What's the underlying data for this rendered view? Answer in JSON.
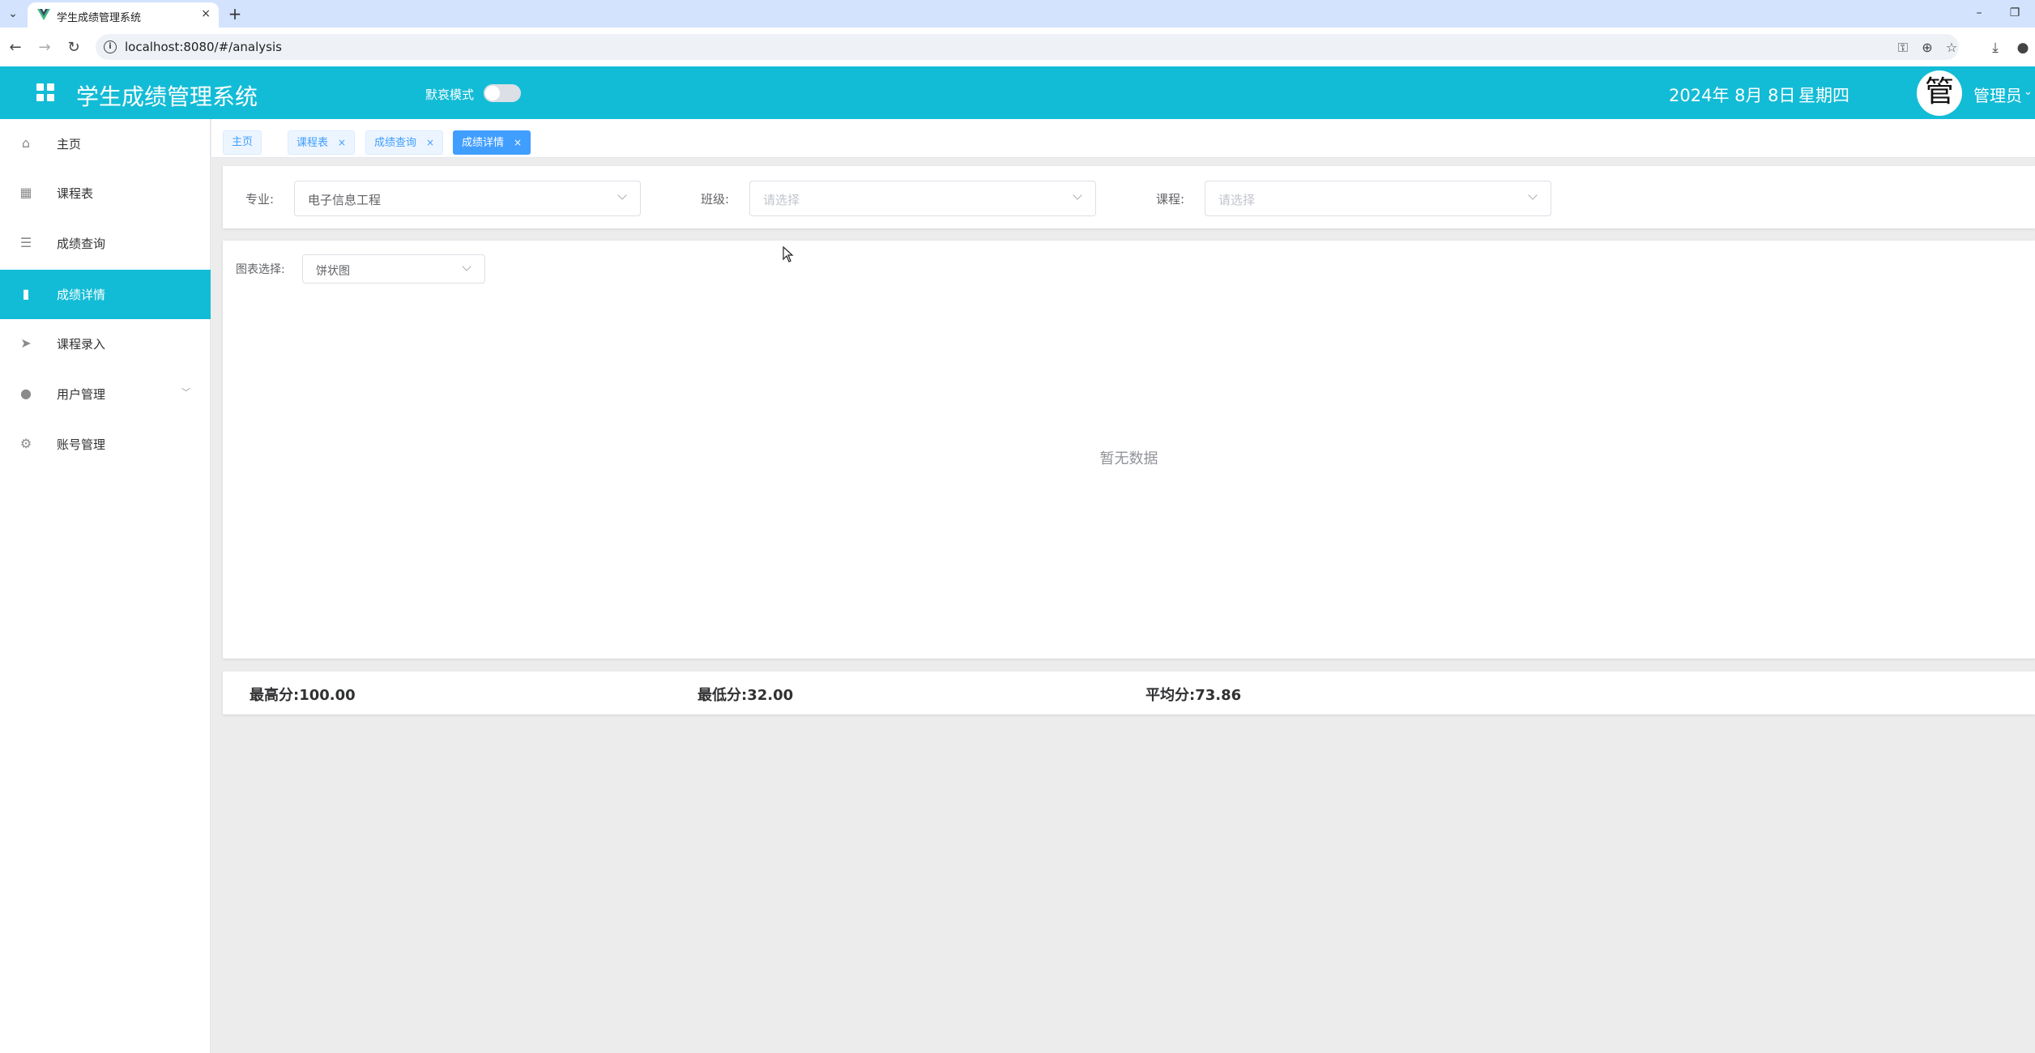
{
  "browser": {
    "tab_title": "学生成绩管理系统",
    "tab_close": "×",
    "new_tab": "+",
    "url": "localhost:8080/#/analysis",
    "icons": [
      "tab-search-icon",
      "back-icon",
      "forward-icon",
      "reload-icon",
      "site-info-icon",
      "password-key-icon",
      "zoom-icon",
      "bookmark-star-icon",
      "download-icon",
      "profile-icon",
      "minimize-icon",
      "restore-icon"
    ]
  },
  "header": {
    "title": "学生成绩管理系统",
    "mode_label": "默哀模式",
    "date": "2024年 8月 8日",
    "weekday": "星期四",
    "avatar_char": "管",
    "user_name": "管理员",
    "accent_color": "#13bcd6"
  },
  "sidebar": {
    "items": [
      {
        "label": "主页",
        "icon": "home-icon",
        "active": false
      },
      {
        "label": "课程表",
        "icon": "grid-icon",
        "active": false
      },
      {
        "label": "成绩查询",
        "icon": "list-icon",
        "active": false
      },
      {
        "label": "成绩详情",
        "icon": "bar-chart-icon",
        "active": true
      },
      {
        "label": "课程录入",
        "icon": "send-icon",
        "active": false
      },
      {
        "label": "用户管理",
        "icon": "user-icon",
        "active": false,
        "has_submenu": true
      },
      {
        "label": "账号管理",
        "icon": "gear-icon",
        "active": false
      }
    ]
  },
  "tags": [
    {
      "label": "主页",
      "closable": false,
      "active": false
    },
    {
      "label": "课程表",
      "closable": true,
      "active": false
    },
    {
      "label": "成绩查询",
      "closable": true,
      "active": false
    },
    {
      "label": "成绩详情",
      "closable": true,
      "active": true
    }
  ],
  "filters": {
    "major_label": "专业:",
    "major_value": "电子信息工程",
    "class_label": "班级:",
    "class_placeholder": "请选择",
    "course_label": "课程:",
    "course_placeholder": "请选择"
  },
  "chart": {
    "select_label": "图表选择:",
    "select_value": "饼状图",
    "empty_text": "暂无数据"
  },
  "stats": {
    "max_label": "最高分:",
    "max_value": "100.00",
    "min_label": "最低分:",
    "min_value": "32.00",
    "avg_label": "平均分:",
    "avg_value": "73.86"
  }
}
